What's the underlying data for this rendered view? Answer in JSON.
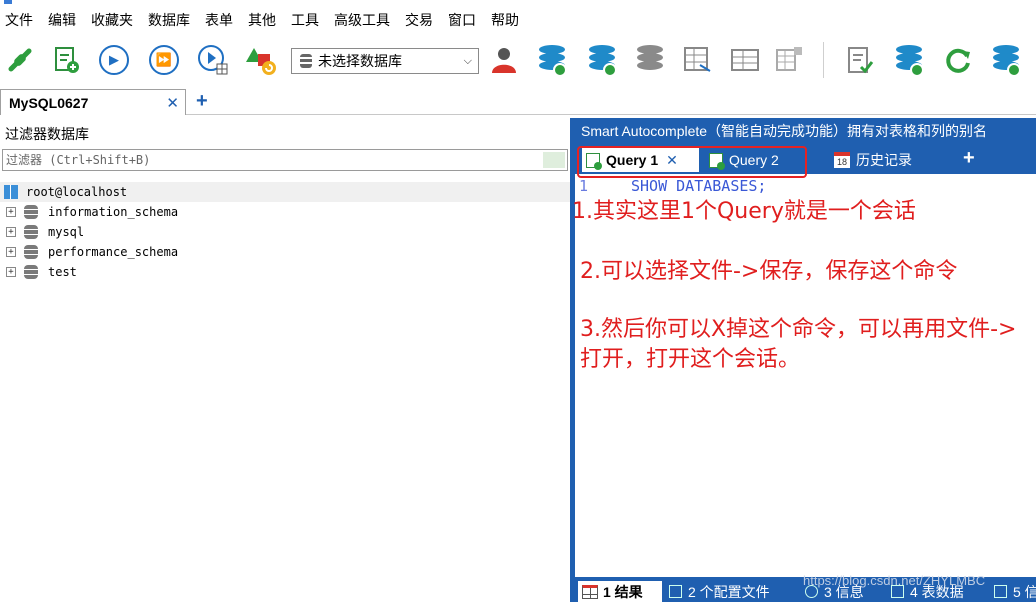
{
  "menu": [
    "文件",
    "编辑",
    "收藏夹",
    "数据库",
    "表单",
    "其他",
    "工具",
    "高级工具",
    "交易",
    "窗口",
    "帮助"
  ],
  "toolbar": {
    "database_select": "未选择数据库"
  },
  "connection_tab": {
    "label": "MySQL0627",
    "close": "✕",
    "add": "+"
  },
  "left_pane": {
    "filter_title": "过滤器数据库",
    "filter_placeholder": "过滤器 (Ctrl+Shift+B)",
    "root": "root@localhost",
    "databases": [
      "information_schema",
      "mysql",
      "performance_schema",
      "test"
    ]
  },
  "right_pane": {
    "smart_autocomplete": "Smart Autocomplete（智能自动完成功能）拥有对表格和列的别名",
    "query_tabs": [
      {
        "label": "Query 1",
        "close": "✕"
      },
      {
        "label": "Query 2"
      },
      {
        "label": "历史记录"
      }
    ],
    "add_tab": "+",
    "editor": {
      "line_number": "1",
      "code": "SHOW DATABASES;"
    },
    "annotations": [
      "1.其实这里1个Query就是一个会话",
      "2.可以选择文件->保存，保存这个命令",
      "3.然后你可以X掉这个命令，可以再用文件->打开，打开这个会话。"
    ],
    "result_tabs": [
      "1 结果",
      "2 个配置文件",
      "3 信息",
      "4 表数据",
      "5 信"
    ],
    "watermark": "https://blog.csdn.net/ZHYLMBC"
  },
  "colors": {
    "accent_blue": "#1f5fb0",
    "annotation_red": "#e01e1e",
    "sql_keyword": "#3a58d6"
  }
}
